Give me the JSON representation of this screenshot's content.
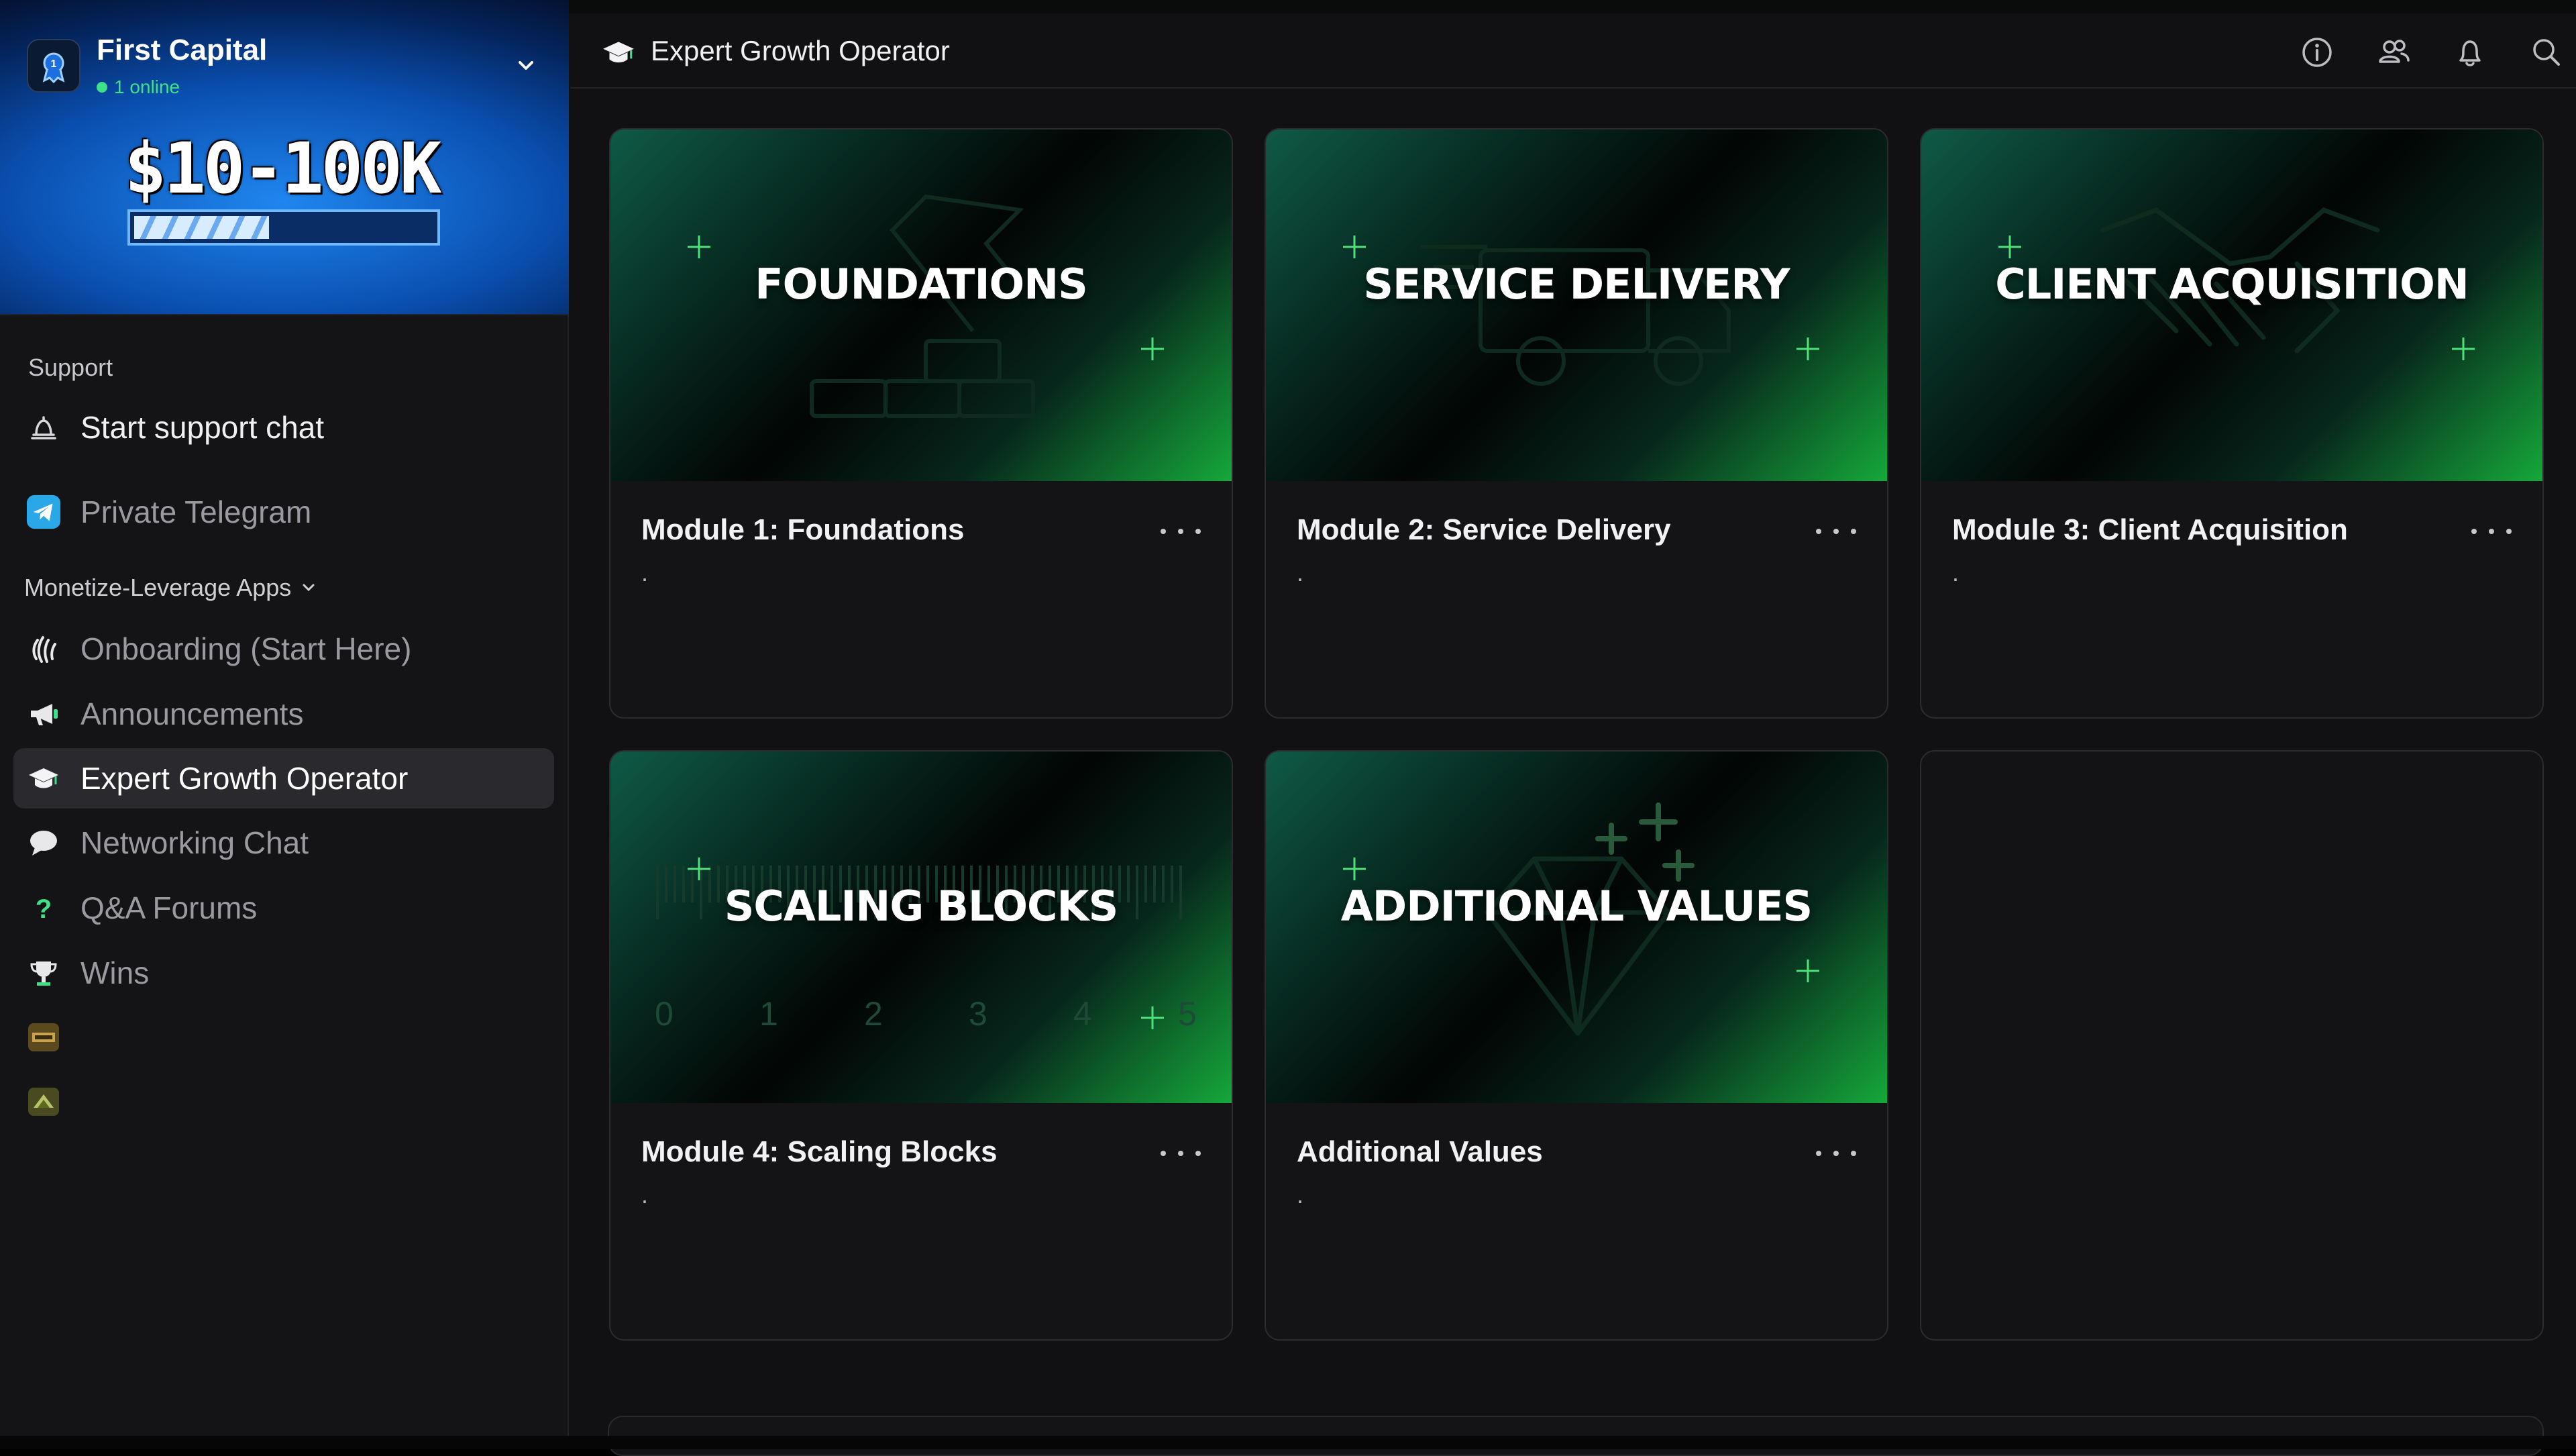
{
  "server": {
    "name": "First Capital",
    "status": "1 online"
  },
  "banner": {
    "title": "$10-100K",
    "progress": 0.45,
    "accent": "#1f86ef"
  },
  "sidebar": {
    "support_label": "Support",
    "support_chat": "Start support chat",
    "telegram": "Private Telegram",
    "group_label": "Monetize-Leverage Apps",
    "items": [
      {
        "label": "Onboarding (Start Here)",
        "icon": "wave-hand-icon"
      },
      {
        "label": "Announcements",
        "icon": "megaphone-icon"
      },
      {
        "label": "Expert Growth Operator",
        "icon": "graduation-cap-icon",
        "active": true
      },
      {
        "label": "Networking Chat",
        "icon": "chat-bubble-icon"
      },
      {
        "label": "Q&A Forums",
        "icon": "question-icon"
      },
      {
        "label": "Wins",
        "icon": "trophy-icon"
      },
      {
        "label": "",
        "icon": "app-thumbnail-icon"
      },
      {
        "label": "",
        "icon": "app-thumbnail-icon"
      }
    ]
  },
  "header": {
    "title": "Expert Growth Operator",
    "tools": [
      "info-icon",
      "members-icon",
      "bell-icon",
      "search-icon"
    ]
  },
  "modules": [
    {
      "thumb": "FOUNDATIONS",
      "title": "Module 1: Foundations",
      "desc": "."
    },
    {
      "thumb": "SERVICE DELIVERY",
      "title": "Module 2: Service Delivery",
      "desc": "."
    },
    {
      "thumb": "CLIENT ACQUISITION",
      "title": "Module 3: Client Acquisition",
      "desc": "."
    },
    {
      "thumb": "SCALING BLOCKS",
      "title": "Module 4: Scaling Blocks",
      "desc": "."
    },
    {
      "thumb": "ADDITIONAL VALUES",
      "title": "Additional Values",
      "desc": "."
    }
  ],
  "scaling_ruler": [
    "0",
    "1",
    "2",
    "3",
    "4",
    "5"
  ],
  "colors": {
    "card_bg": "#141416",
    "thumb_green": "#15a83a",
    "online_green": "#3ee088"
  }
}
